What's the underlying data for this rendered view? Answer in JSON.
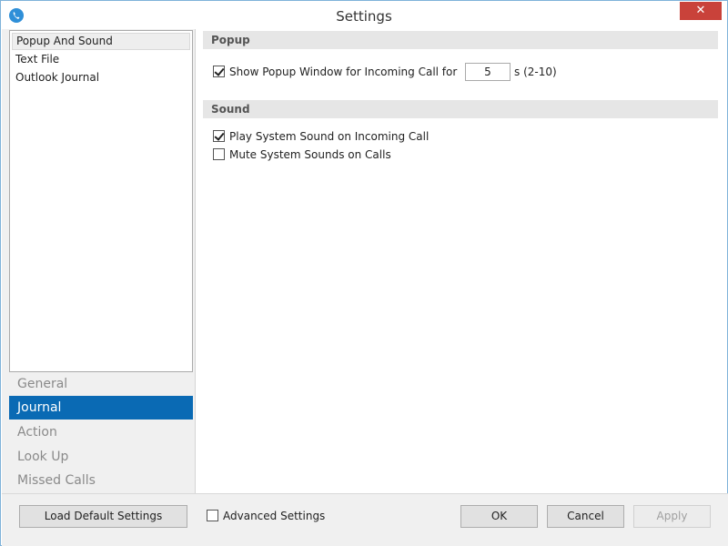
{
  "window": {
    "title": "Settings",
    "close_glyph": "✕"
  },
  "subpages": [
    {
      "label": "Popup And Sound",
      "selected": true
    },
    {
      "label": "Text File",
      "selected": false
    },
    {
      "label": "Outlook Journal",
      "selected": false
    }
  ],
  "categories": [
    {
      "label": "General",
      "active": false
    },
    {
      "label": "Journal",
      "active": true
    },
    {
      "label": "Action",
      "active": false
    },
    {
      "label": "Look Up",
      "active": false
    },
    {
      "label": "Missed Calls",
      "active": false
    }
  ],
  "popup": {
    "header": "Popup",
    "show_popup_label": "Show Popup Window for Incoming Call for",
    "show_popup_checked": true,
    "seconds_value": "5",
    "range_label": "s (2-10)"
  },
  "sound": {
    "header": "Sound",
    "play_sound_label": "Play System Sound on Incoming Call",
    "play_sound_checked": true,
    "mute_label": "Mute System Sounds on Calls",
    "mute_checked": false
  },
  "footer": {
    "load_defaults": "Load Default Settings",
    "advanced_label": "Advanced Settings",
    "advanced_checked": false,
    "ok": "OK",
    "cancel": "Cancel",
    "apply": "Apply"
  },
  "colors": {
    "accent": "#0a6ab4",
    "close_button": "#c9423a",
    "app_icon": "#2f8fd8"
  }
}
